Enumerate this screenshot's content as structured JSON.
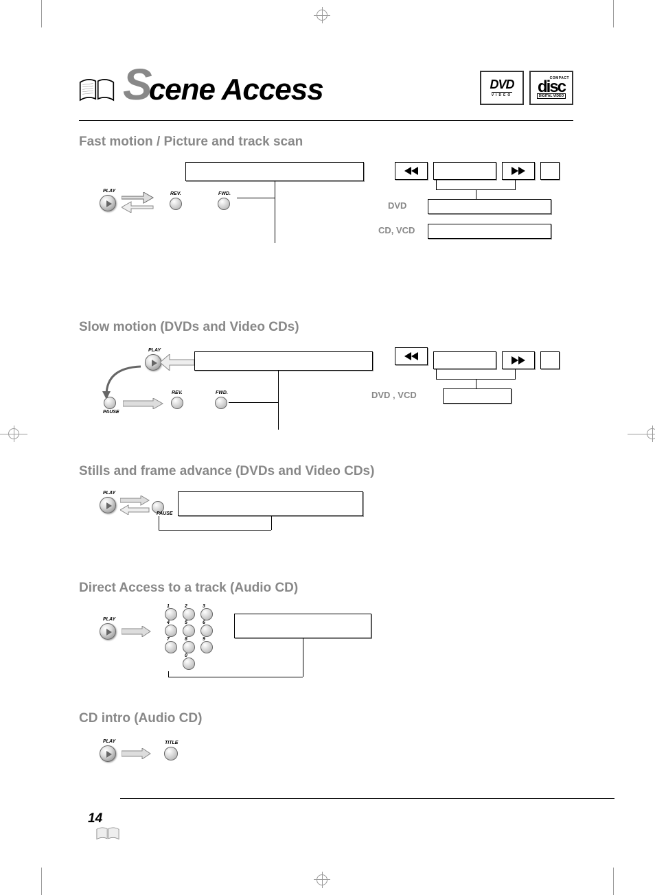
{
  "page_number": "14",
  "title_first_letter": "S",
  "title_rest": "cene Access",
  "logos": {
    "dvd": {
      "main": "DVD",
      "sub": "VIDEO"
    },
    "cd": {
      "top": "COMPACT",
      "mid": "disc",
      "bot": "DIGITAL VIDEO"
    }
  },
  "sections": {
    "fast": {
      "title": "Fast motion / Picture and track scan",
      "labels": {
        "play": "PLAY",
        "rev": "REV.",
        "fwd": "FWD.",
        "dvd": "DVD",
        "cdvcd": "CD, VCD"
      }
    },
    "slow": {
      "title": "Slow motion (DVDs and Video CDs)",
      "labels": {
        "play": "PLAY",
        "pause": "PAUSE",
        "rev": "REV.",
        "fwd": "FWD.",
        "dvdvcd": "DVD , VCD"
      }
    },
    "stills": {
      "title": "Stills and frame advance (DVDs and Video CDs)",
      "labels": {
        "play": "PLAY",
        "pause": "PAUSE"
      }
    },
    "direct": {
      "title": "Direct Access to a track (Audio CD)",
      "labels": {
        "play": "PLAY"
      },
      "keypad": [
        "1",
        "2",
        "3",
        "4",
        "5",
        "6",
        "7",
        "8",
        "9",
        "0"
      ]
    },
    "intro": {
      "title": "CD intro (Audio CD)",
      "labels": {
        "play": "PLAY",
        "title": "TITLE"
      }
    }
  }
}
